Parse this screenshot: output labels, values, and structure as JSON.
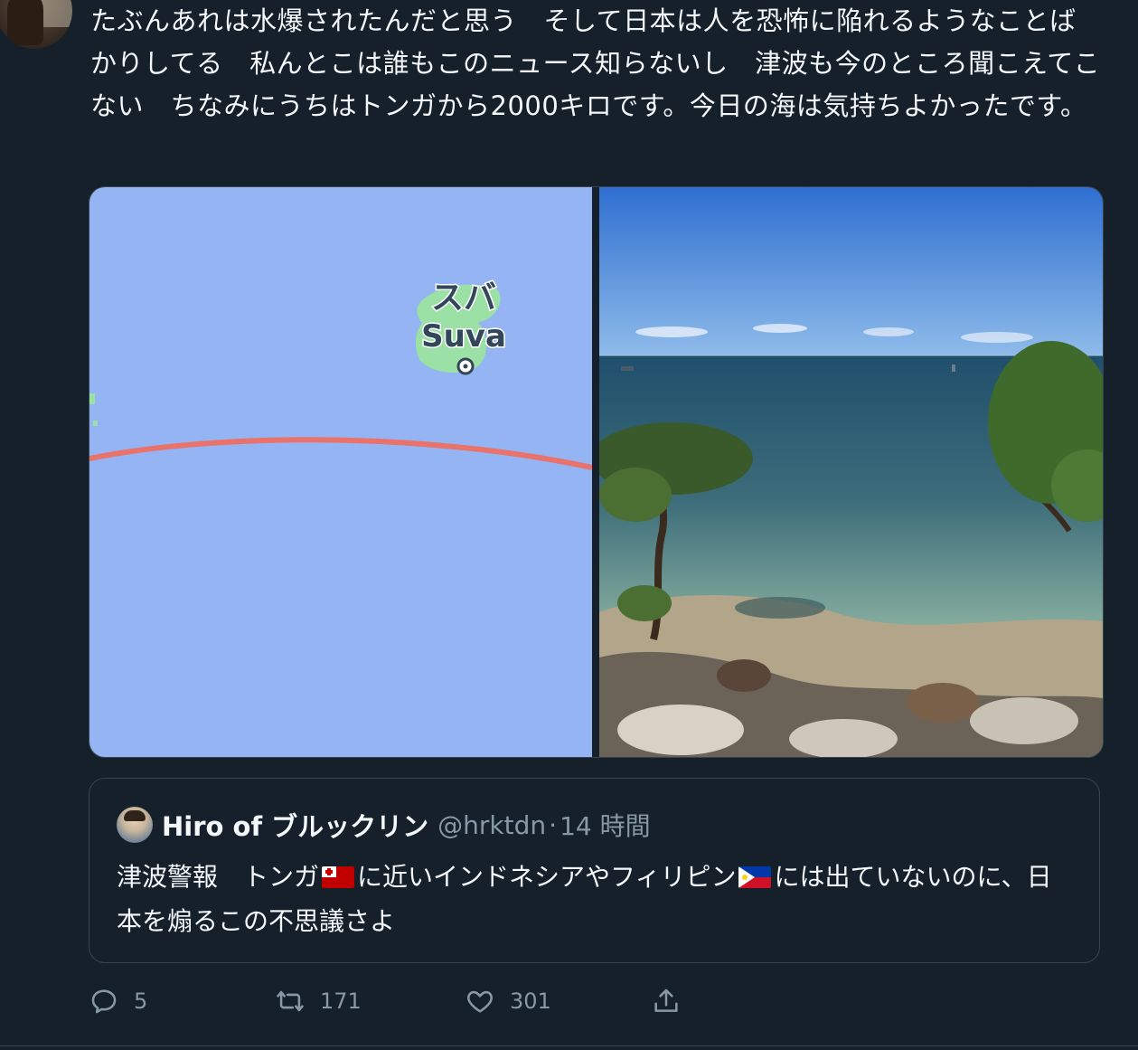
{
  "tweet": {
    "text": "たぶんあれは水爆されたんだと思う　そして日本は人を恐怖に陥れるようなことばかりしてる　私んとこは誰もこのニュース知らないし　津波も今のところ聞こえてこない　ちなみにうちはトンガから2000キロです。今日の海は気持ちよかったです。"
  },
  "media": {
    "map": {
      "label_jp": "スバ",
      "label_en": "Suva",
      "colors": {
        "ocean": "#94b4f4",
        "land": "#9be0a4",
        "route": "#e9726a"
      }
    },
    "photo": {
      "colors": {
        "sky": "#3f7fd8",
        "sea": "#2d5c72",
        "shallow": "#7fa99a"
      }
    }
  },
  "quote": {
    "display_name": "Hiro of ブルックリン",
    "handle": "@hrktdn",
    "separator": "·",
    "time": "14 時間",
    "text_part1": "津波警報　トンガ",
    "text_part2": "に近いインドネシアやフィリピン",
    "text_part3": "には出ていないのに、日本を煽るこの不思議さよ"
  },
  "actions": {
    "reply_count": "5",
    "retweet_count": "171",
    "like_count": "301",
    "icons": [
      "reply-icon",
      "retweet-icon",
      "like-icon",
      "share-icon"
    ]
  },
  "theme": {
    "background": "#15202b",
    "text": "#f5f8fa",
    "muted": "#8899a6",
    "border": "#38444d"
  }
}
